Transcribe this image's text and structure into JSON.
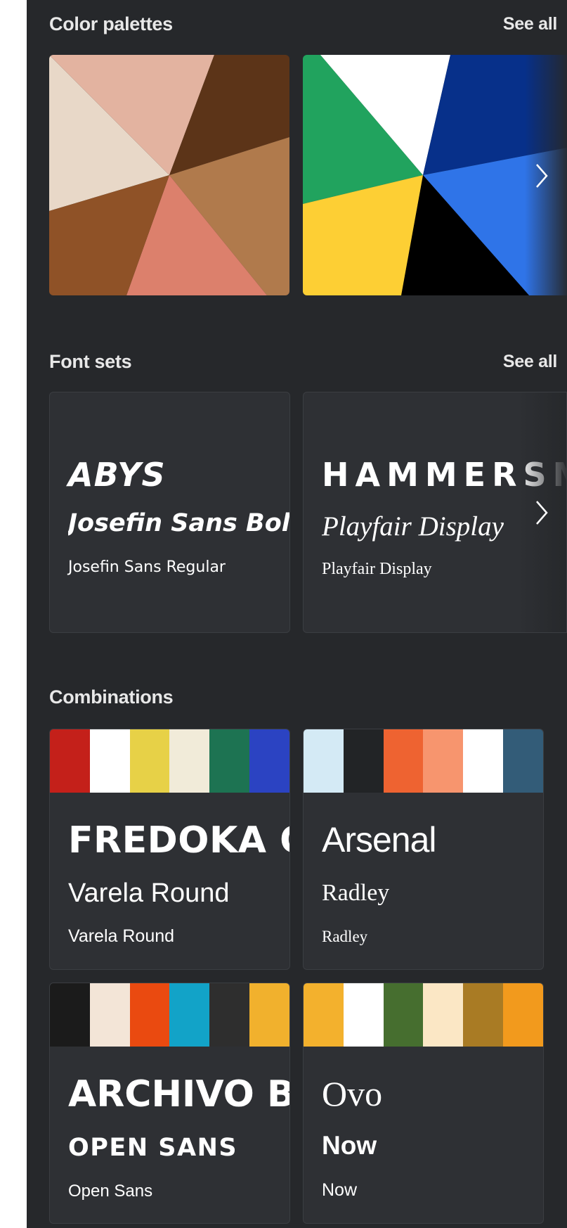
{
  "sections": {
    "color_palettes": {
      "title": "Color palettes",
      "see_all": "See all"
    },
    "font_sets": {
      "title": "Font sets",
      "see_all": "See all"
    },
    "combinations": {
      "title": "Combinations"
    }
  },
  "palettes": [
    {
      "colors": [
        "#e8d8c8",
        "#e3b3a0",
        "#5c3418",
        "#b07a4c",
        "#dc806c",
        "#8f5227"
      ]
    },
    {
      "colors": [
        "#21a35e",
        "#ffffff",
        "#07308a",
        "#2f74e8",
        "#000000",
        "#fdcf34"
      ]
    }
  ],
  "font_sets": [
    {
      "display": "ABYS",
      "heading": "Josefin Sans Bold",
      "body": "Josefin Sans Regular"
    },
    {
      "display": "HAMMERSMITH",
      "heading": "Playfair Display",
      "body": "Playfair Display"
    }
  ],
  "combinations": [
    {
      "colors": [
        "#c4201a",
        "#ffffff",
        "#e7d147",
        "#f1ebd9",
        "#1d7352",
        "#2b43c2"
      ],
      "display": "FREDOKA ONE",
      "heading": "Varela Round",
      "body": "Varela Round"
    },
    {
      "colors": [
        "#d4eaf5",
        "#222426",
        "#ee6331",
        "#f7956e",
        "#ffffff",
        "#335c78"
      ],
      "display": "Arsenal",
      "heading": "Radley",
      "body": "Radley"
    },
    {
      "colors": [
        "#1b1b1b",
        "#f3e5d7",
        "#ea4a10",
        "#12a3c8",
        "#2e2e2e",
        "#f1b12d"
      ],
      "display": "ARCHIVO BLACK",
      "heading": "OPEN SANS",
      "body": "Open Sans"
    },
    {
      "colors": [
        "#f3b12d",
        "#ffffff",
        "#466e2f",
        "#fbe7c5",
        "#a97b24",
        "#f29a1d"
      ],
      "display": "Ovo",
      "heading": "Now",
      "body": "Now"
    }
  ],
  "icons": {
    "next": "chevron-right-icon"
  }
}
